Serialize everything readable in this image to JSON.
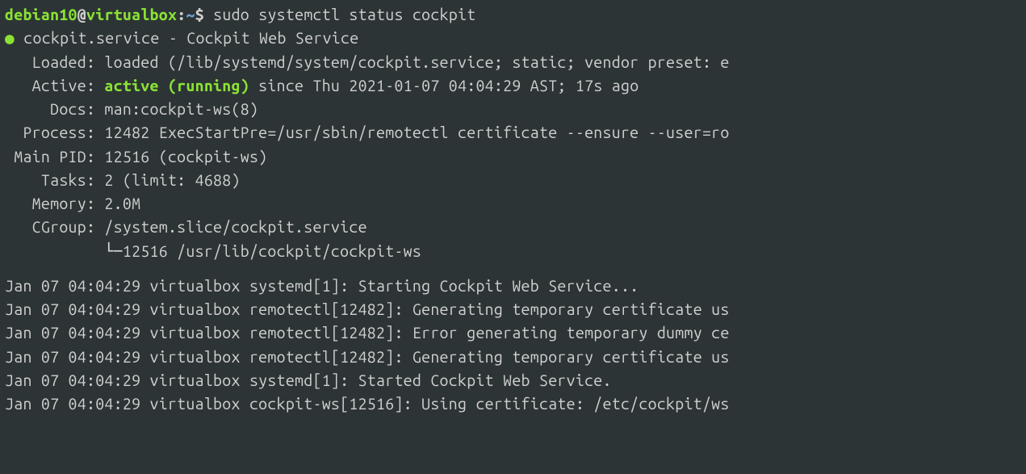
{
  "prompt": {
    "user": "debian10",
    "host": "virtualbox",
    "path": "~",
    "symbol": "$"
  },
  "command": "sudo systemctl status cockpit",
  "service": {
    "bullet": "●",
    "name": "cockpit.service",
    "desc": "Cockpit Web Service"
  },
  "status": {
    "loaded_label": "   Loaded: ",
    "loaded_value": "loaded (/lib/systemd/system/cockpit.service; static; vendor preset: e",
    "active_label": "   Active: ",
    "active_state": "active (running)",
    "active_rest": " since Thu 2021-01-07 04:04:29 AST; 17s ago",
    "docs_label": "     Docs: ",
    "docs_value": "man:cockpit-ws(8)",
    "process_label": "  Process: ",
    "process_value": "12482 ExecStartPre=/usr/sbin/remotectl certificate --ensure --user=ro",
    "mainpid_label": " Main PID: ",
    "mainpid_value": "12516 (cockpit-ws)",
    "tasks_label": "    Tasks: ",
    "tasks_value": "2 (limit: 4688)",
    "memory_label": "   Memory: ",
    "memory_value": "2.0M",
    "cgroup_label": "   CGroup: ",
    "cgroup_value": "/system.slice/cockpit.service",
    "cgroup_tree": "           └─12516 /usr/lib/cockpit/cockpit-ws"
  },
  "log_lines": [
    "Jan 07 04:04:29 virtualbox systemd[1]: Starting Cockpit Web Service...",
    "Jan 07 04:04:29 virtualbox remotectl[12482]: Generating temporary certificate us",
    "Jan 07 04:04:29 virtualbox remotectl[12482]: Error generating temporary dummy ce",
    "Jan 07 04:04:29 virtualbox remotectl[12482]: Generating temporary certificate us",
    "Jan 07 04:04:29 virtualbox systemd[1]: Started Cockpit Web Service.",
    "Jan 07 04:04:29 virtualbox cockpit-ws[12516]: Using certificate: /etc/cockpit/ws"
  ]
}
